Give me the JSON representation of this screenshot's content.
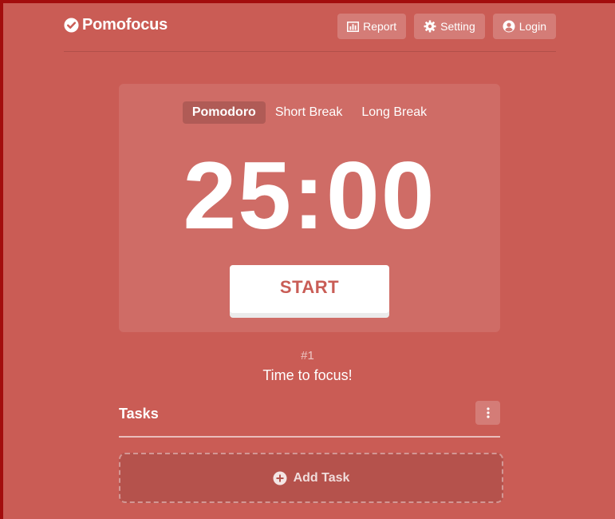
{
  "header": {
    "brand": "Pomofocus",
    "nav": {
      "report": "Report",
      "setting": "Setting",
      "login": "Login"
    }
  },
  "timer": {
    "modes": {
      "pomodoro": "Pomodoro",
      "short_break": "Short Break",
      "long_break": "Long Break"
    },
    "active_mode": "pomodoro",
    "time": "25:00",
    "start_label": "START"
  },
  "session": {
    "number": "#1",
    "message": "Time to focus!"
  },
  "tasks": {
    "title": "Tasks",
    "add_label": "Add Task"
  },
  "colors": {
    "background": "#ca5c55",
    "accent": "#c95d56",
    "border": "#a30d0d"
  },
  "icons": {
    "brand": "check-circle-icon",
    "report": "bar-chart-icon",
    "setting": "gear-icon",
    "login": "user-circle-icon",
    "tasks_menu": "vertical-dots-icon",
    "add_task": "plus-circle-icon"
  }
}
